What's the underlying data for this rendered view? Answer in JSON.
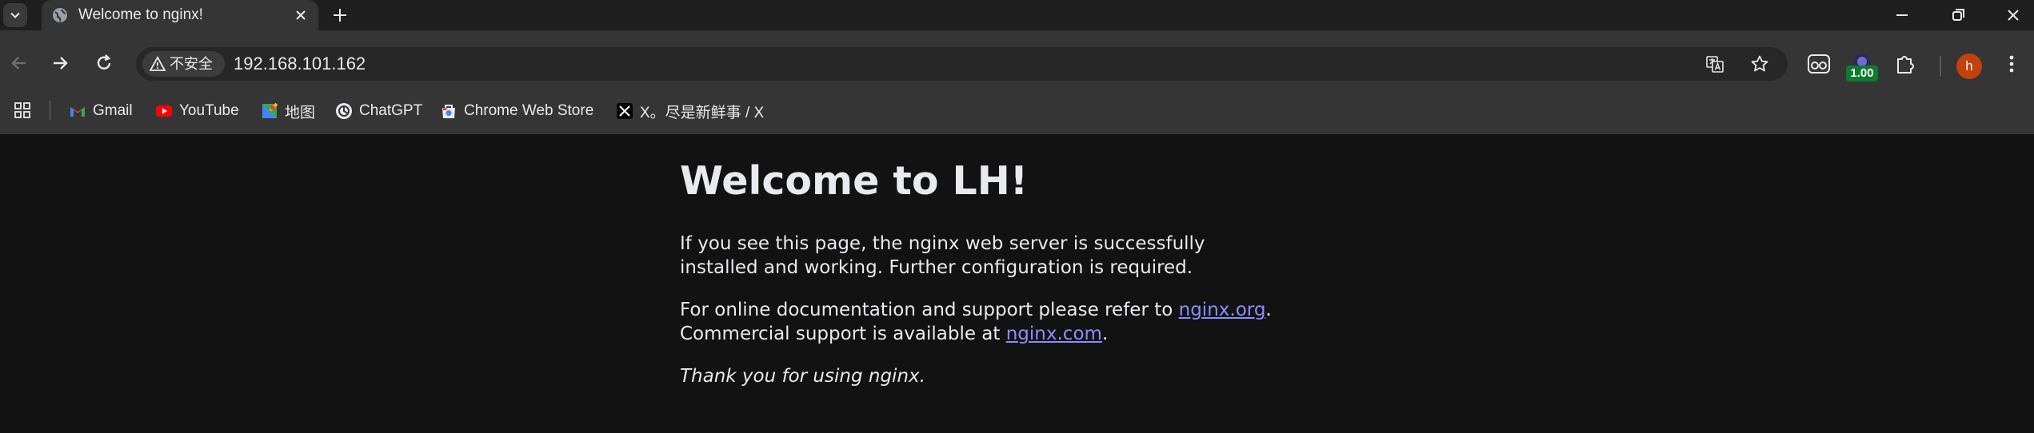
{
  "tab": {
    "title": "Welcome to nginx!"
  },
  "toolbar": {
    "security_label": "不安全",
    "url": "192.168.101.162"
  },
  "extension_badge": "1.00",
  "profile_initial": "h",
  "bookmarks": [
    {
      "label": "Gmail",
      "icon": "gmail-icon"
    },
    {
      "label": "YouTube",
      "icon": "youtube-icon"
    },
    {
      "label": "地图",
      "icon": "maps-icon"
    },
    {
      "label": "ChatGPT",
      "icon": "chatgpt-icon"
    },
    {
      "label": "Chrome Web Store",
      "icon": "chrome-web-store-icon"
    },
    {
      "label": "X。尽是新鲜事 / X",
      "icon": "x-icon"
    }
  ],
  "page": {
    "heading": "Welcome to LH!",
    "para1": "If you see this page, the nginx web server is successfully installed and working. Further configuration is required.",
    "para2_before": "For online documentation and support please refer to ",
    "link1": "nginx.org",
    "para2_mid": ".",
    "para2_line2": "Commercial support is available at ",
    "link2": "nginx.com",
    "para2_end": ".",
    "thanks": "Thank you for using nginx."
  },
  "colors": {
    "page_bg": "#121212",
    "link": "#8c8cff",
    "toolbar_bg": "#353535",
    "tabstrip_bg": "#1f1f1f"
  }
}
